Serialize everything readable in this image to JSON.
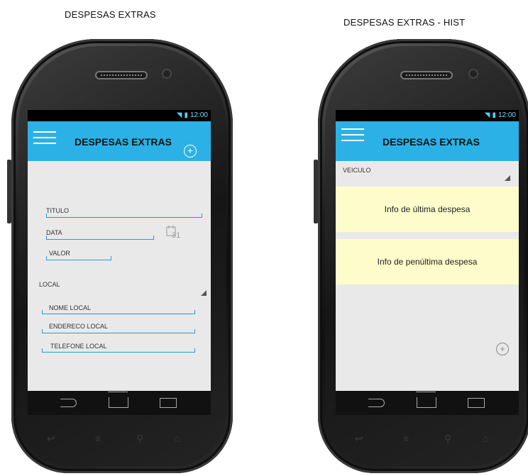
{
  "captions": {
    "left": "DESPESAS EXTRAS",
    "right": "DESPESAS EXTRAS - HIST"
  },
  "status_bar": {
    "time": "12:00",
    "icons": [
      "wifi-icon",
      "signal-icon",
      "battery-icon"
    ]
  },
  "form_screen": {
    "app_title": "DESPESAS EXTRAS",
    "fields": {
      "titulo": "TITULO",
      "data": "DATA",
      "valor": "VALOR",
      "local": "LOCAL",
      "nome_local": "NOME LOCAL",
      "endereco_local": "ENDERECO LOCAL",
      "telefone_local": "TELEFONE LOCAL"
    },
    "calendar_day": "31"
  },
  "hist_screen": {
    "app_title": "DESPESAS EXTRAS",
    "vehicle_spinner": "VEICULO",
    "cards": [
      "Info de última despesa",
      "Info de penúltima despesa"
    ]
  },
  "hardware_keys": [
    "↩",
    "≡",
    "⚲",
    "⌂"
  ]
}
